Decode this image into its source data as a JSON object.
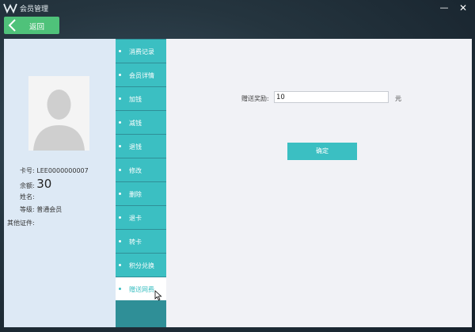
{
  "window": {
    "title": "会员管理",
    "minimize_icon": "minimize-icon",
    "close_icon": "close-icon"
  },
  "back_button": {
    "label": "返回",
    "icon": "chevron-left-icon"
  },
  "member": {
    "card_label": "卡号:",
    "card_no": "LEE0000000007",
    "balance_label": "余额:",
    "balance": "30",
    "name_label": "姓名:",
    "name": "",
    "level_label": "等级:",
    "level": "普通会员",
    "id_label": "其他证件:",
    "id_value": ""
  },
  "nav": {
    "items": [
      {
        "label": "消费记录"
      },
      {
        "label": "会员详情"
      },
      {
        "label": "加钱"
      },
      {
        "label": "减钱"
      },
      {
        "label": "退钱"
      },
      {
        "label": "修改"
      },
      {
        "label": "删除"
      },
      {
        "label": "退卡"
      },
      {
        "label": "转卡"
      },
      {
        "label": "积分兑换"
      },
      {
        "label": "赠送网费"
      }
    ],
    "active_index": 10
  },
  "form": {
    "gift_label": "赠送奖励:",
    "gift_value": "10",
    "unit": "元",
    "confirm_label": "确定"
  },
  "colors": {
    "accent": "#3bbfc2",
    "back_green": "#4fc27a",
    "panel": "#dde9f5",
    "content": "#f1f2f6"
  }
}
